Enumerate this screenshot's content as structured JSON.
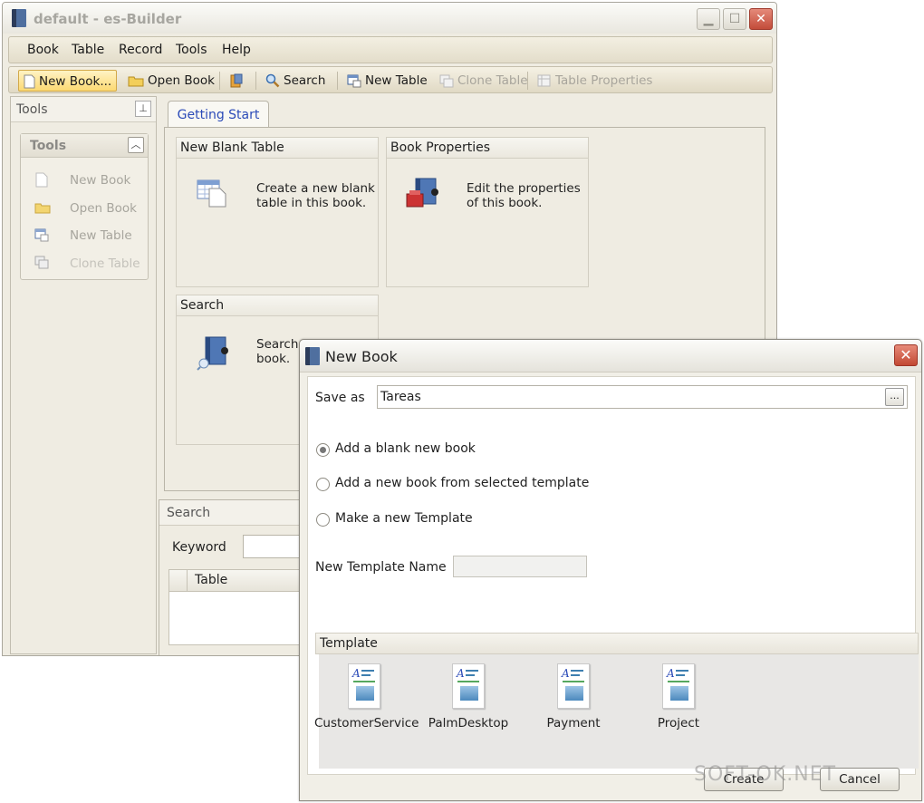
{
  "main_window": {
    "title": "default - es-Builder",
    "menu": [
      "Book",
      "Table",
      "Record",
      "Tools",
      "Help"
    ],
    "toolbar": {
      "new_book": "New Book...",
      "open_book": "Open Book",
      "search": "Search",
      "new_table": "New Table",
      "clone_table": "Clone Table",
      "table_properties": "Table Properties"
    }
  },
  "tools_panel": {
    "title": "Tools",
    "group_title": "Tools",
    "items": [
      "New Book",
      "Open Book",
      "New Table",
      "Clone Table"
    ]
  },
  "getting_start": {
    "tab_label": "Getting Start",
    "cards": [
      {
        "title": "New Blank Table",
        "desc_line1": "Create a new blank",
        "desc_line2": "table in this book."
      },
      {
        "title": "Book Properties",
        "desc_line1": "Edit the properties",
        "desc_line2": "of this book."
      },
      {
        "title": "Search",
        "desc_line1": "Search data in this",
        "desc_line2": "book."
      }
    ]
  },
  "search_panel": {
    "title": "Search",
    "keyword_label": "Keyword",
    "keyword_value": "",
    "column_header": "Table"
  },
  "dialog": {
    "title": "New Book",
    "save_as_label": "Save as",
    "save_as_value": "Tareas",
    "browse_label": "...",
    "options": [
      "Add a blank new book",
      "Add a new book from selected template",
      "Make a new Template"
    ],
    "selected_option": 0,
    "template_name_label": "New Template Name",
    "template_name_value": "",
    "template_section_label": "Template",
    "templates": [
      "CustomerService",
      "PalmDesktop",
      "Payment",
      "Project"
    ],
    "create_button": "Create",
    "cancel_button": "Cancel"
  },
  "watermark": "SOFT-OK.NET"
}
